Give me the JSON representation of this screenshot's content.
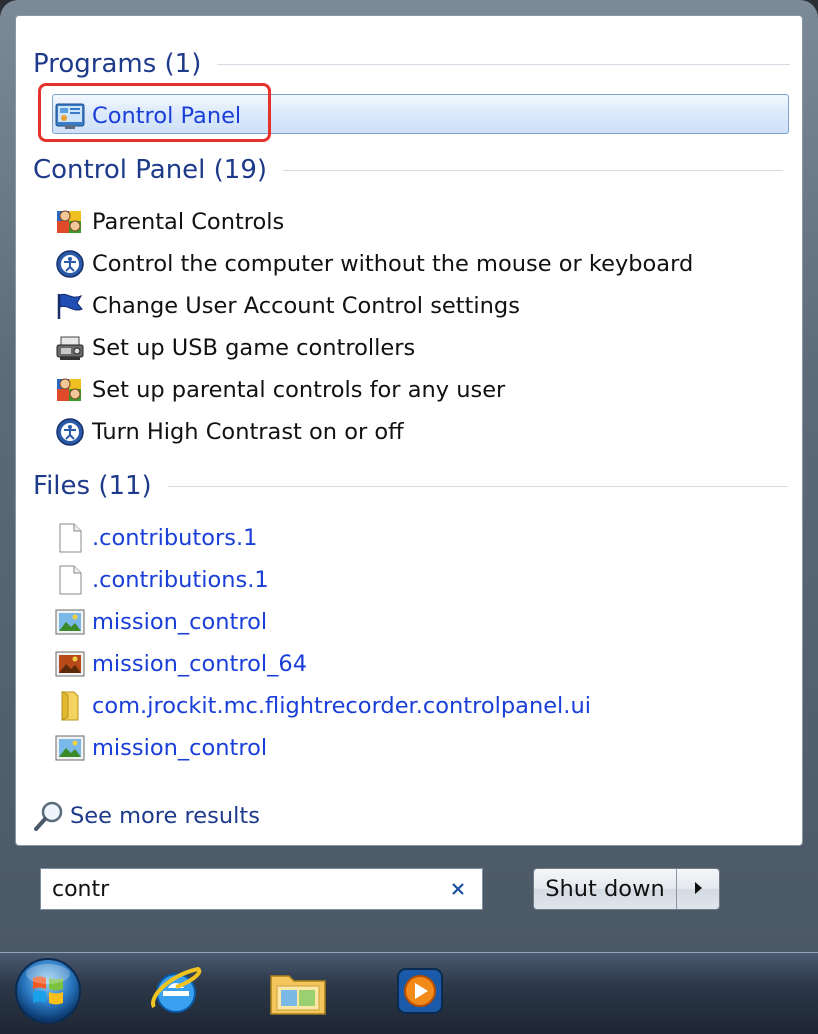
{
  "programs": {
    "header": "Programs (1)",
    "items": [
      {
        "label": "Control Panel",
        "icon": "control-panel-icon"
      }
    ]
  },
  "control_panel": {
    "header": "Control Panel (19)",
    "items": [
      {
        "label": "Parental Controls",
        "icon": "parental-controls-icon"
      },
      {
        "label": "Control the computer without the mouse or keyboard",
        "icon": "ease-of-access-icon"
      },
      {
        "label": "Change User Account Control settings",
        "icon": "uac-flag-icon"
      },
      {
        "label": "Set up USB game controllers",
        "icon": "game-controller-icon"
      },
      {
        "label": "Set up parental controls for any user",
        "icon": "parental-controls-icon"
      },
      {
        "label": "Turn High Contrast on or off",
        "icon": "ease-of-access-icon"
      }
    ]
  },
  "files": {
    "header": "Files (11)",
    "items": [
      {
        "label": ".contributors.1",
        "icon": "document-icon"
      },
      {
        "label": ".contributions.1",
        "icon": "document-icon"
      },
      {
        "label": "mission_control",
        "icon": "image-file-icon"
      },
      {
        "label": "mission_control_64",
        "icon": "image-file-icon"
      },
      {
        "label": "com.jrockit.mc.flightrecorder.controlpanel.ui",
        "icon": "folder-icon"
      },
      {
        "label": "mission_control",
        "icon": "image-file-icon"
      }
    ]
  },
  "see_more": {
    "label": "See more results",
    "icon": "search-icon"
  },
  "search": {
    "value": "contr"
  },
  "shutdown": {
    "label": "Shut down"
  },
  "taskbar": {
    "items": [
      {
        "icon": "windows-start-orb-icon"
      },
      {
        "icon": "internet-explorer-icon"
      },
      {
        "icon": "windows-explorer-folder-icon"
      },
      {
        "icon": "media-player-icon"
      }
    ]
  },
  "colors": {
    "accent": "#1a3fd8",
    "header": "#1e3a8a",
    "highlight": "#e5322d"
  }
}
